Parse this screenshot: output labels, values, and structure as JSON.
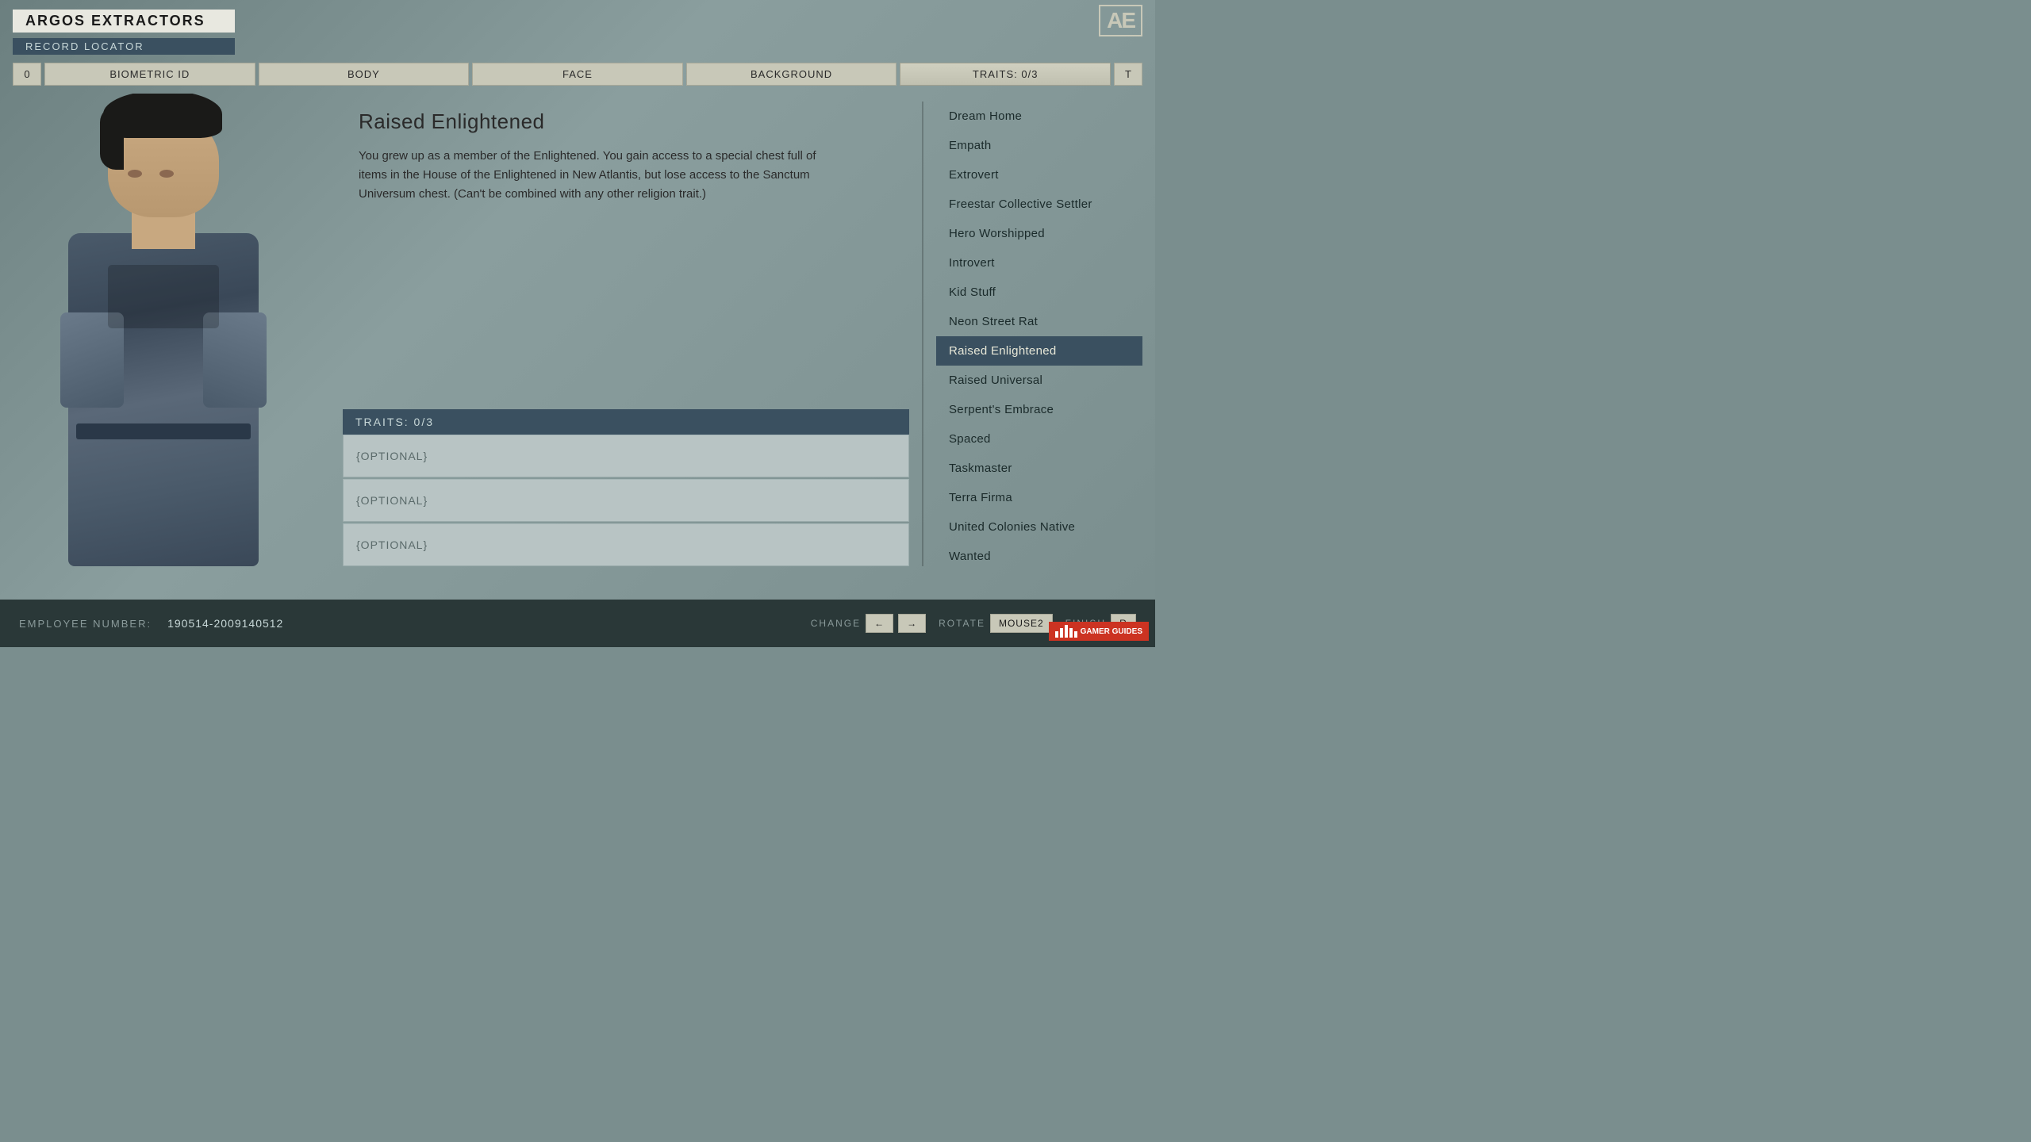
{
  "header": {
    "company_name": "ARGOS EXTRACTORS",
    "record_locator": "RECORD LOCATOR",
    "ae_logo": "AE"
  },
  "nav": {
    "left_button": "0",
    "right_button": "T",
    "tabs": [
      {
        "id": "biometric",
        "label": "BIOMETRIC ID",
        "active": false
      },
      {
        "id": "body",
        "label": "BODY",
        "active": false
      },
      {
        "id": "face",
        "label": "FACE",
        "active": false
      },
      {
        "id": "background",
        "label": "BACKGROUND",
        "active": false
      },
      {
        "id": "traits",
        "label": "TRAITS: 0/3",
        "active": true
      }
    ]
  },
  "trait_detail": {
    "title": "Raised Enlightened",
    "description": "You grew up as a member of the Enlightened. You gain access to a special chest full of items in the House of the Enlightened in New Atlantis, but lose access to the Sanctum Universum chest. (Can't be combined with any other religion trait.)"
  },
  "traits_panel": {
    "header": "TRAITS: 0/3",
    "slots": [
      {
        "label": "{OPTIONAL}"
      },
      {
        "label": "{OPTIONAL}"
      },
      {
        "label": "{OPTIONAL}"
      }
    ]
  },
  "trait_list": {
    "items": [
      {
        "id": "dream-home",
        "label": "Dream Home",
        "selected": false
      },
      {
        "id": "empath",
        "label": "Empath",
        "selected": false
      },
      {
        "id": "extrovert",
        "label": "Extrovert",
        "selected": false
      },
      {
        "id": "freestar",
        "label": "Freestar Collective Settler",
        "selected": false
      },
      {
        "id": "hero-worshipped",
        "label": "Hero Worshipped",
        "selected": false
      },
      {
        "id": "introvert",
        "label": "Introvert",
        "selected": false
      },
      {
        "id": "kid-stuff",
        "label": "Kid Stuff",
        "selected": false
      },
      {
        "id": "neon-street-rat",
        "label": "Neon Street Rat",
        "selected": false
      },
      {
        "id": "raised-enlightened",
        "label": "Raised Enlightened",
        "selected": true
      },
      {
        "id": "raised-universal",
        "label": "Raised Universal",
        "selected": false
      },
      {
        "id": "serpents-embrace",
        "label": "Serpent's Embrace",
        "selected": false
      },
      {
        "id": "spaced",
        "label": "Spaced",
        "selected": false
      },
      {
        "id": "taskmaster",
        "label": "Taskmaster",
        "selected": false
      },
      {
        "id": "terra-firma",
        "label": "Terra Firma",
        "selected": false
      },
      {
        "id": "united-colonies",
        "label": "United Colonies Native",
        "selected": false
      },
      {
        "id": "wanted",
        "label": "Wanted",
        "selected": false
      }
    ]
  },
  "bottom_bar": {
    "employee_label": "EMPLOYEE NUMBER:",
    "employee_number": "190514-2009140512",
    "change_label": "CHANGE",
    "change_keys": [
      "←",
      "→"
    ],
    "rotate_label": "ROTATE",
    "rotate_key": "MOUSE2",
    "finish_label": "FINISH",
    "finish_key": "R"
  },
  "watermark": {
    "text": "GAMER GUIDES"
  }
}
